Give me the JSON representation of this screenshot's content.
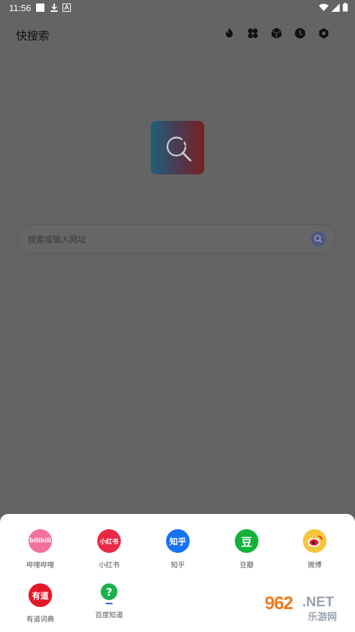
{
  "status_bar": {
    "time": "11:56"
  },
  "app": {
    "title": "快搜索"
  },
  "toolbar": {
    "icons": [
      "fire-icon",
      "clover-icon",
      "cube-icon",
      "clock-icon",
      "settings-icon"
    ]
  },
  "search": {
    "placeholder": "搜索或输入网址"
  },
  "sites": [
    {
      "label": "哔哩哔哩",
      "icon_text": "bilibili",
      "color": "#f2729c"
    },
    {
      "label": "小红书",
      "icon_text": "小红书",
      "color": "#ea2a45"
    },
    {
      "label": "知乎",
      "icon_text": "知乎",
      "color": "#1772f6"
    },
    {
      "label": "豆瓣",
      "icon_text": "豆",
      "color": "#12b13a"
    },
    {
      "label": "微博",
      "icon_text": "",
      "color": "#f5c63c"
    },
    {
      "label": "有道词典",
      "icon_text": "有道",
      "color": "#e4192b"
    },
    {
      "label": "百度知道",
      "icon_text": "?",
      "color": "#19b14c"
    }
  ],
  "watermark": {
    "number": "962",
    "suffix": ".NET",
    "text": "乐游网"
  }
}
